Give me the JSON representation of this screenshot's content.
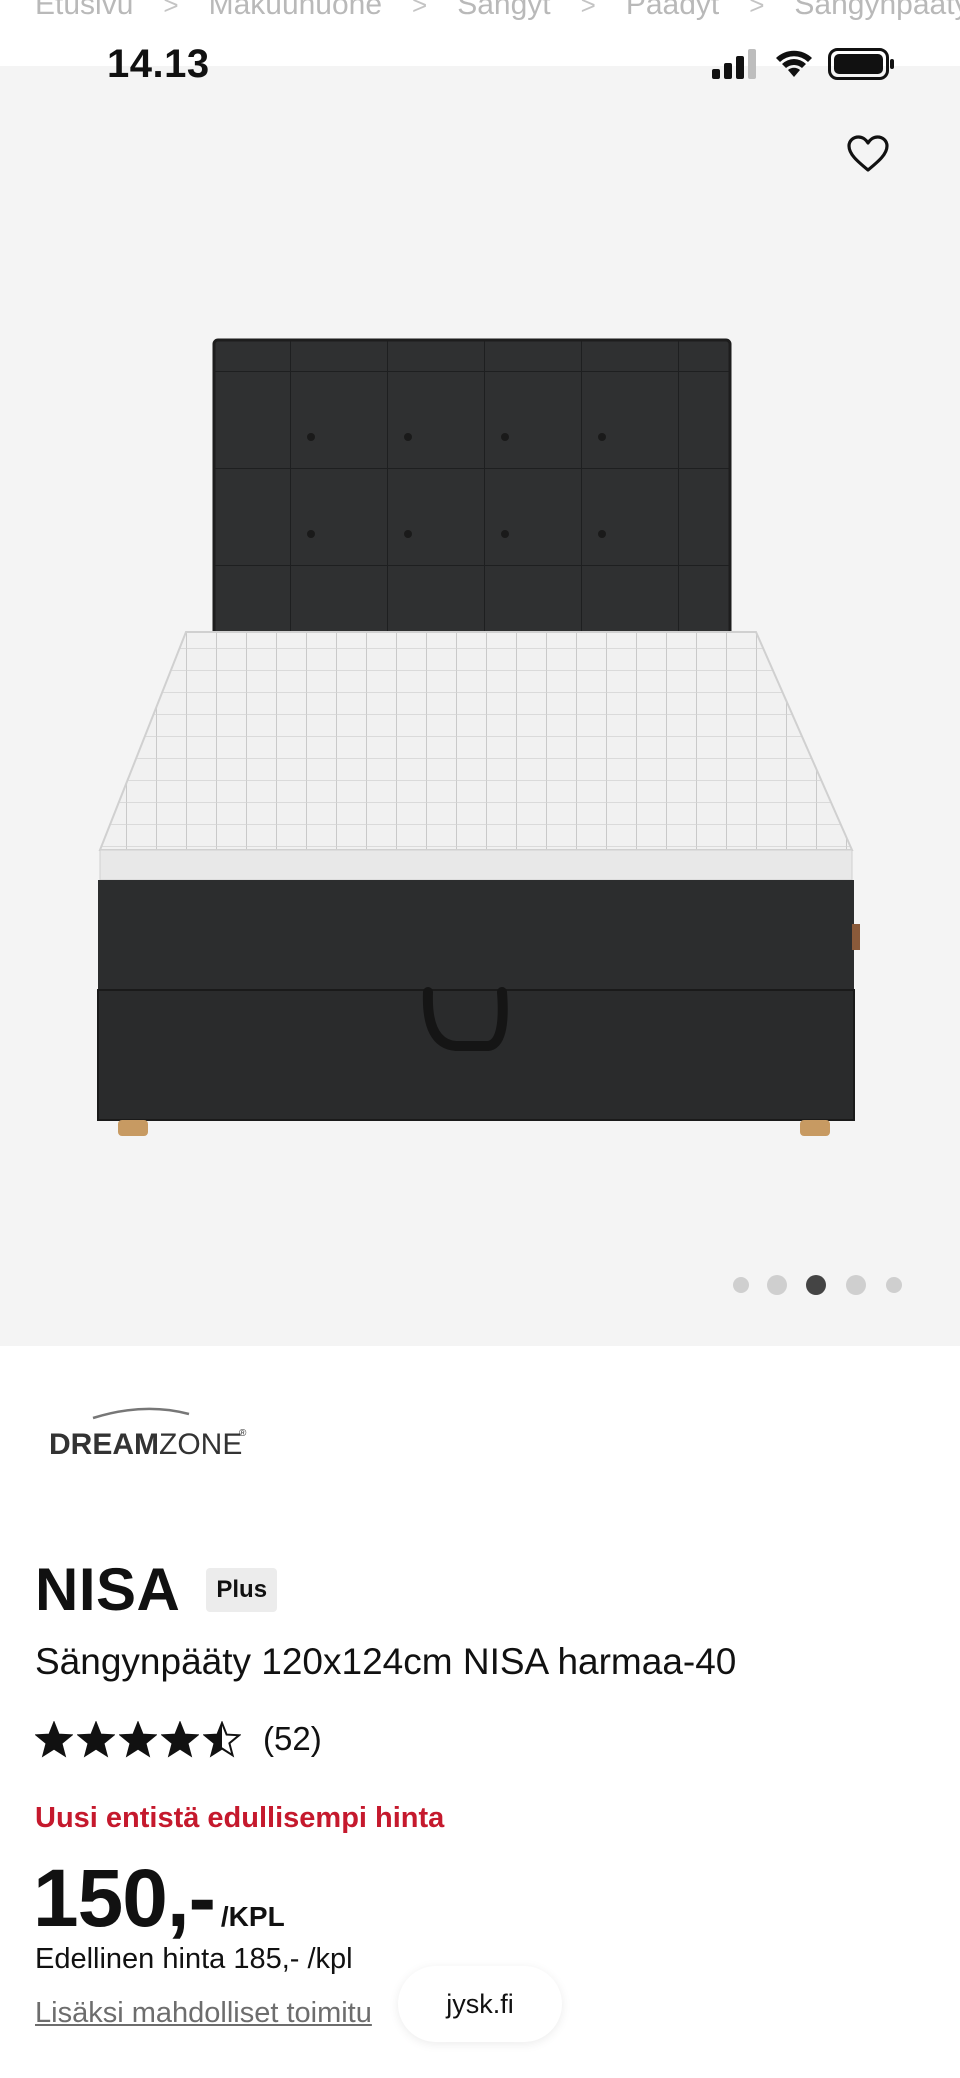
{
  "breadcrumb": {
    "items": [
      "Etusivu",
      "Makuuhuone",
      "Sängyt",
      "Päädyt",
      "Sängynpääty"
    ],
    "separator": ">"
  },
  "status_bar": {
    "time": "14.13",
    "icons": [
      "cellular-signal-icon",
      "wifi-icon",
      "battery-icon"
    ]
  },
  "gallery": {
    "favorite_icon": "heart-outline-icon",
    "image_subject": "bed-with-headboard",
    "slide_count": 5,
    "active_slide": 3
  },
  "product": {
    "brand_logo": "DREAMZONE",
    "name": "NISA",
    "badge": "Plus",
    "subtitle": "Sängynpääty 120x124cm NISA harmaa-40",
    "rating": 4.5,
    "rating_max": 5,
    "review_count": "(52)",
    "price_note": "Uusi entistä edullisempi hinta",
    "price": "150,-",
    "price_unit": "/KPL",
    "previous_price": "Edellinen hinta 185,- /kpl",
    "shipping_link": "Lisäksi mahdolliset toimitu"
  },
  "browser": {
    "url": "jysk.fi"
  },
  "colors": {
    "price_note": "#c5192d",
    "hero_background": "#f4f4f4",
    "active_dot": "#444444",
    "inactive_dot": "#cfcfcf"
  }
}
